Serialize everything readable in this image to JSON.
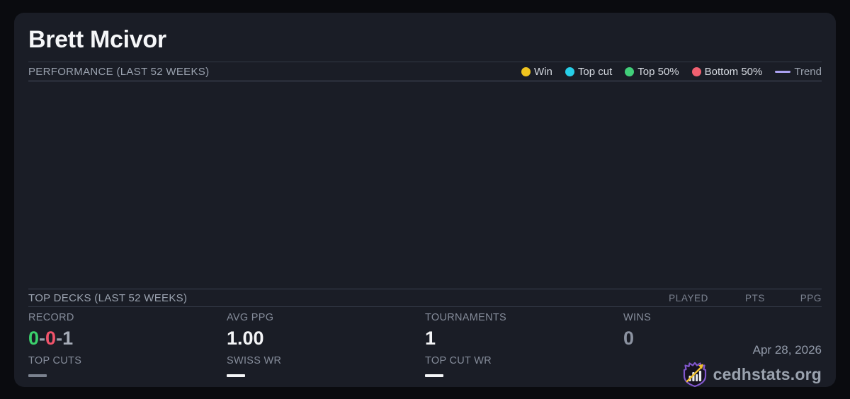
{
  "page": {
    "title": "Brett Mcivor"
  },
  "performance": {
    "heading": "PERFORMANCE (LAST 52 WEEKS)",
    "legend": {
      "items": [
        {
          "label": "Win",
          "color": "#f0c41f",
          "swatch": "dot"
        },
        {
          "label": "Top cut",
          "color": "#27cfe8",
          "swatch": "dot"
        },
        {
          "label": "Top 50%",
          "color": "#41ce79",
          "swatch": "dot"
        },
        {
          "label": "Bottom 50%",
          "color": "#f06070",
          "swatch": "dot"
        },
        {
          "label": "Trend",
          "color": "#aaa0f0",
          "swatch": "line"
        }
      ]
    },
    "chart": {
      "type": "scatter",
      "points": []
    }
  },
  "top_decks": {
    "heading": "TOP DECKS (LAST 52 WEEKS)",
    "columns": [
      "PLAYED",
      "PTS",
      "PPG"
    ],
    "rows": []
  },
  "stats": {
    "record": {
      "label": "RECORD",
      "wins": "0",
      "losses": "0",
      "draws": "1",
      "separator": "-",
      "wins_color": "#3bd06c",
      "losses_color": "#f0536a",
      "draws_color": "#a6acb8"
    },
    "avg_ppg": {
      "label": "AVG PPG",
      "value": "1.00"
    },
    "tournaments": {
      "label": "TOURNAMENTS",
      "value": "1"
    },
    "wins": {
      "label": "WINS",
      "value": "0"
    },
    "top_cuts": {
      "label": "TOP CUTS",
      "value": "—"
    },
    "swiss_wr": {
      "label": "SWISS WR",
      "value": "—"
    },
    "top_cut_wr": {
      "label": "TOP CUT WR",
      "value": "—"
    }
  },
  "footer": {
    "date": "Apr 28, 2026",
    "brand": "cedhstats.org"
  },
  "colors": {
    "background": "#0a0b0f",
    "card": "#1a1d26",
    "accent_purple": "#8157cc",
    "arrow_gold": "#f0c02c"
  }
}
